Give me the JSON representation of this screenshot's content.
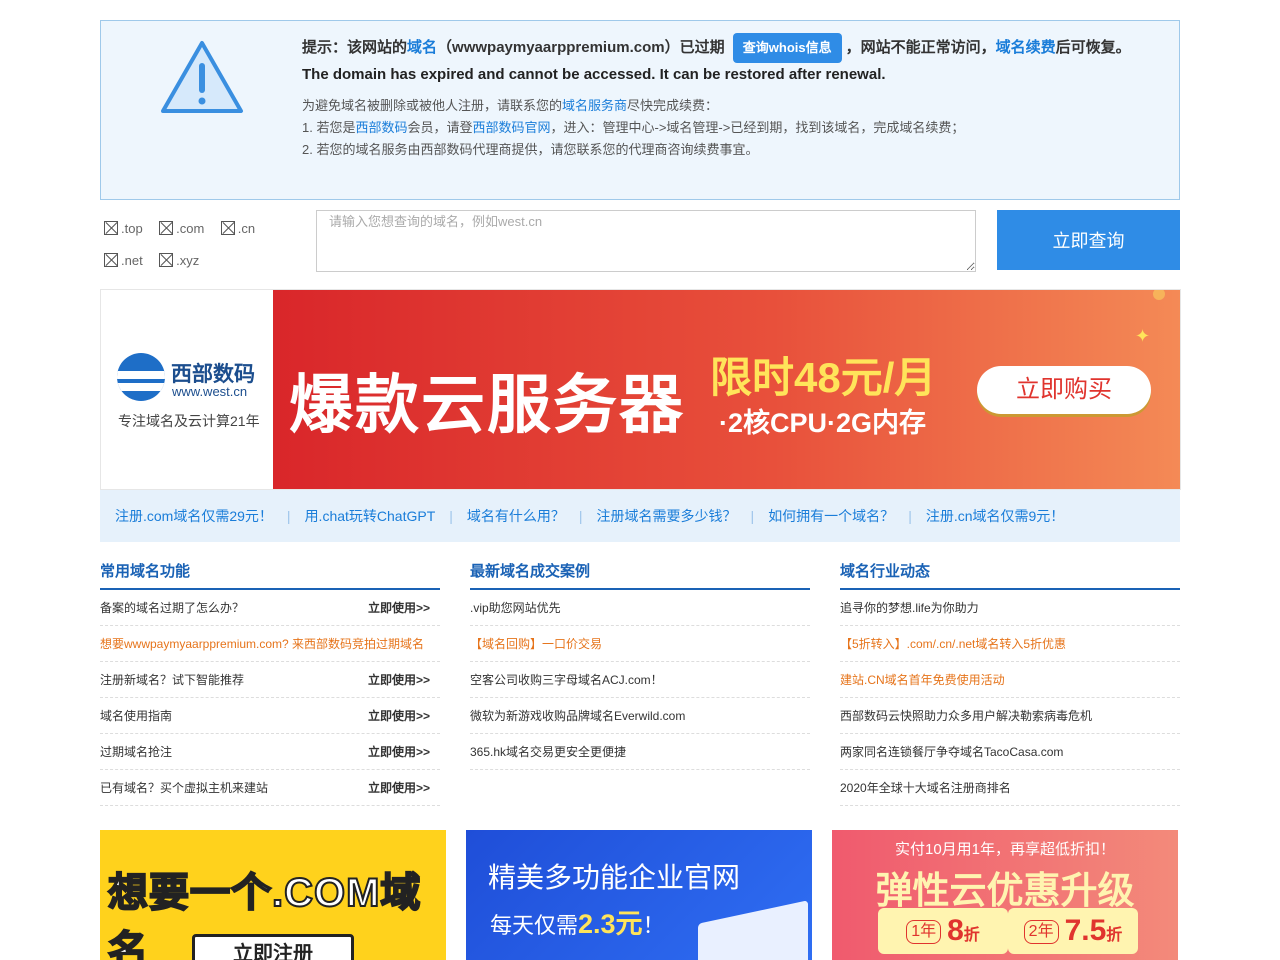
{
  "notice": {
    "prefix": "提示：该网站的",
    "domain_word": "域名",
    "domain_name": "（wwwpaymyaarppremium.com）已过期",
    "whois_button": "查询whois信息",
    "mid": "，网站不能正常访问，",
    "renew_word": "域名续费",
    "suffix": "后可恢复。",
    "english": "The domain has expired and cannot be accessed. It can be restored after renewal.",
    "tip_a": "为避免域名被删除或被他人注册，请联系您的",
    "tip_link": "域名服务商",
    "tip_b": "尽快完成续费：",
    "step1_a": "1. 若您是",
    "step1_link1": "西部数码",
    "step1_b": "会员，请登",
    "step1_link2": "西部数码官网",
    "step1_c": "，进入：管理中心->域名管理->已经到期，找到该域名，完成域名续费；",
    "step2": "2. 若您的域名服务由西部数码代理商提供，请您联系您的代理商咨询续费事宜。"
  },
  "search": {
    "tlds": [
      ".top",
      ".com",
      ".cn",
      ".net",
      ".xyz"
    ],
    "placeholder": "请输入您想查询的域名，例如west.cn",
    "button": "立即查询"
  },
  "banner": {
    "logo_name": "西部数码",
    "logo_url": "www.west.cn",
    "slogan": "专注域名及云计算21年",
    "title": "爆款云服务器",
    "price": "限时48元/月",
    "spec": "·2核CPU·2G内存",
    "buy": "立即购买"
  },
  "linkbar": [
    "注册.com域名仅需29元！",
    "用.chat玩转ChatGPT",
    "域名有什么用？",
    "注册域名需要多少钱？",
    "如何拥有一个域名？",
    "注册.cn域名仅需9元！"
  ],
  "columns": {
    "col1": {
      "title": "常用域名功能",
      "use_label": "立即使用>>",
      "items": [
        "备案的域名过期了怎么办？",
        "想要wwwpaymyaarppremium.com? 来西部数码竞拍过期域名",
        "注册新域名？试下智能推荐",
        "域名使用指南",
        "过期域名抢注",
        "已有域名？买个虚拟主机来建站"
      ]
    },
    "col2": {
      "title": "最新域名成交案例",
      "items": [
        ".vip助您网站优先",
        "【域名回购】一口价交易",
        "空客公司收购三字母域名ACJ.com！",
        "微软为新游戏收购品牌域名Everwild.com",
        "365.hk域名交易更安全更便捷"
      ]
    },
    "col3": {
      "title": "域名行业动态",
      "items": [
        "追寻你的梦想.life为你助力",
        "【5折转入】.com/.cn/.net域名转入5折优惠",
        "建站.CN域名首年免费使用活动",
        "西部数码云快照助力众多用户解决勒索病毒危机",
        "两家同名连锁餐厅争夺域名TacoCasa.com",
        "2020年全球十大域名注册商排名"
      ]
    }
  },
  "ads": {
    "ad1_text": "想要一个.COM域名",
    "ad1_button": "立即注册",
    "ad2_title": "精美多功能企业官网",
    "ad2_sub_a": "每天仅需",
    "ad2_price": "2.3元",
    "ad2_sub_b": "！",
    "ad3_top": "实付10月用1年，再享超低折扣！",
    "ad3_title": "弹性云优惠升级",
    "ad3_p1_year": "1年",
    "ad3_p1_val": "8",
    "ad3_p2_year": "2年",
    "ad3_p2_val": "7.5",
    "ad3_unit": "折"
  },
  "colors": {
    "accent": "#2f8ce6",
    "link": "#1a7dd9",
    "orange": "#e6741b",
    "banner_red": "#d9262a"
  }
}
